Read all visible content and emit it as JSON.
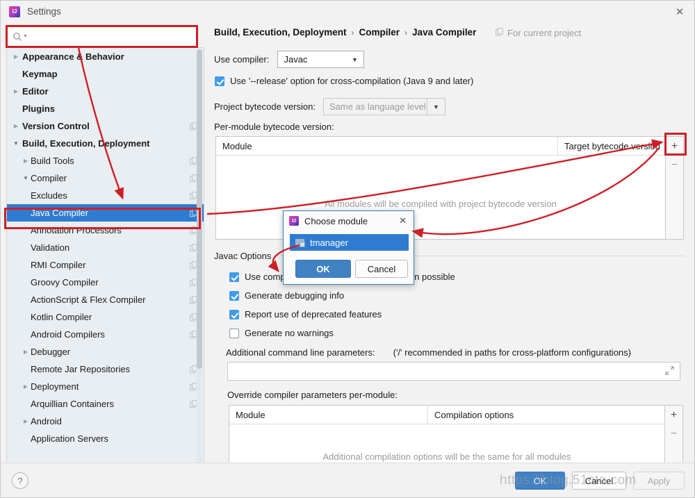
{
  "window": {
    "title": "Settings",
    "app_icon": "intellij-idea-icon",
    "close_icon": "close-icon"
  },
  "search": {
    "icon": "search-icon",
    "value": "",
    "placeholder": ""
  },
  "sidebar": {
    "items": [
      {
        "label": "Appearance & Behavior",
        "level": 0,
        "arrow": "collapsed",
        "copy": false,
        "selected": false
      },
      {
        "label": "Keymap",
        "level": 0,
        "arrow": "none",
        "copy": false,
        "selected": false
      },
      {
        "label": "Editor",
        "level": 0,
        "arrow": "collapsed",
        "copy": false,
        "selected": false
      },
      {
        "label": "Plugins",
        "level": 0,
        "arrow": "none",
        "copy": false,
        "selected": false
      },
      {
        "label": "Version Control",
        "level": 0,
        "arrow": "collapsed",
        "copy": true,
        "selected": false
      },
      {
        "label": "Build, Execution, Deployment",
        "level": 0,
        "arrow": "expanded",
        "copy": false,
        "selected": false
      },
      {
        "label": "Build Tools",
        "level": 1,
        "arrow": "collapsed",
        "copy": true,
        "selected": false
      },
      {
        "label": "Compiler",
        "level": 1,
        "arrow": "expanded",
        "copy": true,
        "selected": false
      },
      {
        "label": "Excludes",
        "level": 2,
        "arrow": "none",
        "copy": true,
        "selected": false
      },
      {
        "label": "Java Compiler",
        "level": 2,
        "arrow": "none",
        "copy": true,
        "selected": true
      },
      {
        "label": "Annotation Processors",
        "level": 2,
        "arrow": "none",
        "copy": true,
        "selected": false
      },
      {
        "label": "Validation",
        "level": 2,
        "arrow": "none",
        "copy": true,
        "selected": false
      },
      {
        "label": "RMI Compiler",
        "level": 2,
        "arrow": "none",
        "copy": true,
        "selected": false
      },
      {
        "label": "Groovy Compiler",
        "level": 2,
        "arrow": "none",
        "copy": true,
        "selected": false
      },
      {
        "label": "ActionScript & Flex Compiler",
        "level": 2,
        "arrow": "none",
        "copy": true,
        "selected": false
      },
      {
        "label": "Kotlin Compiler",
        "level": 2,
        "arrow": "none",
        "copy": true,
        "selected": false
      },
      {
        "label": "Android Compilers",
        "level": 2,
        "arrow": "none",
        "copy": true,
        "selected": false
      },
      {
        "label": "Debugger",
        "level": 1,
        "arrow": "collapsed",
        "copy": false,
        "selected": false
      },
      {
        "label": "Remote Jar Repositories",
        "level": 1,
        "arrow": "none",
        "copy": true,
        "selected": false
      },
      {
        "label": "Deployment",
        "level": 1,
        "arrow": "collapsed",
        "copy": true,
        "selected": false
      },
      {
        "label": "Arquillian Containers",
        "level": 1,
        "arrow": "none",
        "copy": true,
        "selected": false
      },
      {
        "label": "Android",
        "level": 1,
        "arrow": "collapsed",
        "copy": false,
        "selected": false
      },
      {
        "label": "Application Servers",
        "level": 1,
        "arrow": "none",
        "copy": false,
        "selected": false
      }
    ]
  },
  "main": {
    "breadcrumb": [
      "Build, Execution, Deployment",
      "Compiler",
      "Java Compiler"
    ],
    "breadcrumb_separator": "›",
    "for_current_project": "For current project",
    "for_current_project_icon": "copy-icon",
    "use_compiler_label": "Use compiler:",
    "use_compiler_value": "Javac",
    "release_option_label": "Use '--release' option for cross-compilation (Java 9 and later)",
    "release_option_checked": true,
    "project_bytecode_label": "Project bytecode version:",
    "project_bytecode_value": "Same as language level",
    "per_module_label": "Per-module bytecode version:",
    "per_module_table": {
      "columns": [
        "Module",
        "Target bytecode version"
      ],
      "rows": [],
      "empty_message": "All modules will be compiled with project bytecode version",
      "add_button": "+",
      "remove_button": "−"
    },
    "javac_options_group": "Javac Options",
    "javac_checkboxes": [
      {
        "label": "Use compiler from module target JDK when possible",
        "checked": true
      },
      {
        "label": "Generate debugging info",
        "checked": true
      },
      {
        "label": "Report use of deprecated features",
        "checked": true
      },
      {
        "label": "Generate no warnings",
        "checked": false
      }
    ],
    "additional_params_label": "Additional command line parameters:",
    "additional_params_hint": "('/' recommended in paths for cross-platform configurations)",
    "additional_params_value": "",
    "expand_icon": "expand-icon",
    "override_label": "Override compiler parameters per-module:",
    "override_table": {
      "columns": [
        "Module",
        "Compilation options"
      ],
      "rows": [],
      "empty_message": "Additional compilation options will be the same for all modules",
      "add_button": "+",
      "remove_button": "−"
    }
  },
  "choose_module_dialog": {
    "title": "Choose module",
    "app_icon": "intellij-idea-icon",
    "close_icon": "close-icon",
    "modules": [
      {
        "name": "tmanager",
        "icon": "module-icon",
        "selected": true
      }
    ],
    "ok_label": "OK",
    "cancel_label": "Cancel"
  },
  "footer": {
    "help_label": "?",
    "ok_label": "OK",
    "cancel_label": "Cancel",
    "apply_label": "Apply",
    "apply_disabled": true
  },
  "watermark": {
    "text": "https://blog.51cto.com"
  },
  "colors": {
    "accent_blue": "#2f7bd1",
    "primary_button": "#4082c4",
    "annotation_red": "#cc2026",
    "checkbox_blue": "#3f9ce8",
    "sidebar_bg": "#e9eef2"
  }
}
